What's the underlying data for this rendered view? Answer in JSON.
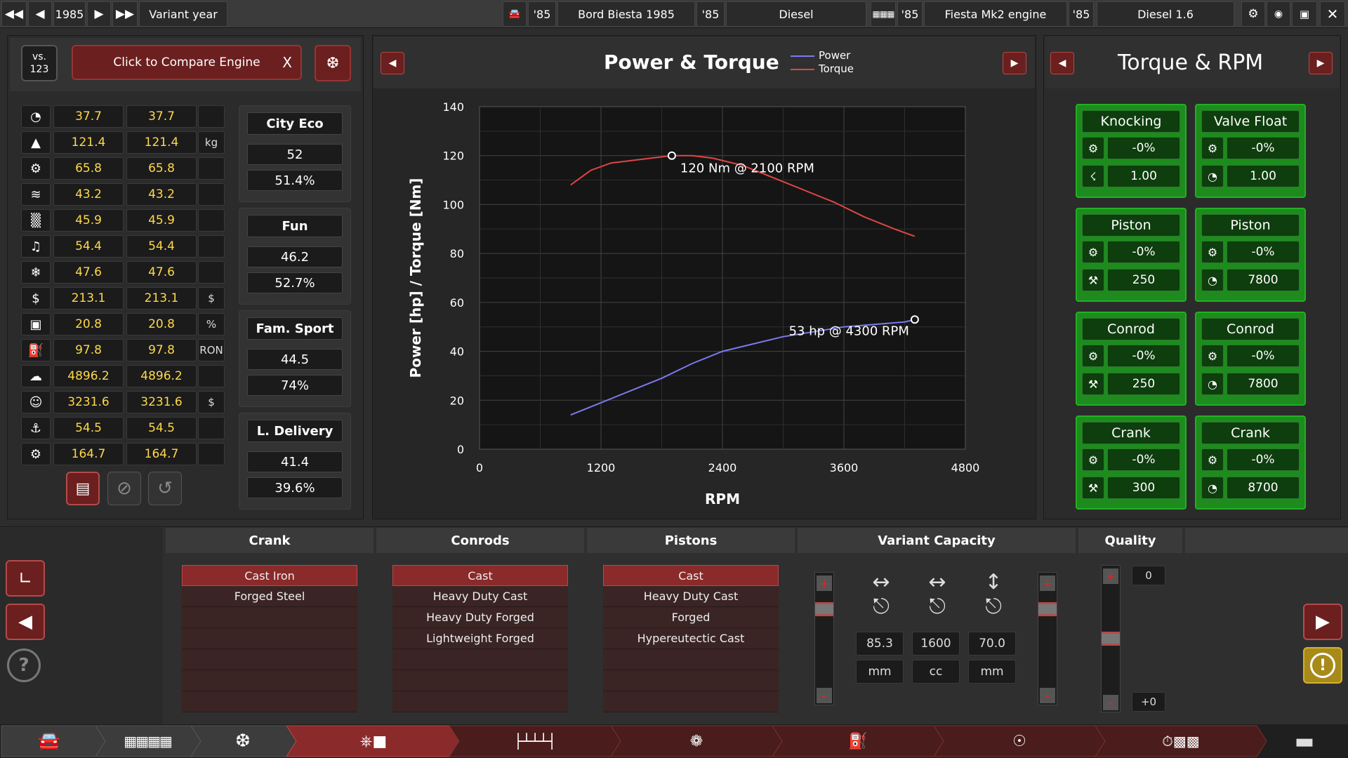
{
  "topbar": {
    "year": "1985",
    "variant_year_label": "Variant year",
    "car_year": "'85",
    "car_name": "Bord Biesta 1985",
    "trim_year": "'85",
    "trim_name": "Diesel",
    "engine_year": "'85",
    "engine_name": "Fiesta Mk2 engine",
    "variant_year": "'85",
    "variant_name": "Diesel 1.6"
  },
  "compare": {
    "vs_label": "vs.\n123",
    "compare_label": "Click to Compare Engine",
    "close": "X"
  },
  "stats": [
    {
      "icon": "speedometer-icon",
      "a": "37.7",
      "b": "37.7",
      "unit": ""
    },
    {
      "icon": "weight-icon",
      "a": "121.4",
      "b": "121.4",
      "unit": "kg"
    },
    {
      "icon": "engine-icon",
      "a": "65.8",
      "b": "65.8",
      "unit": ""
    },
    {
      "icon": "smoothness-icon",
      "a": "43.2",
      "b": "43.2",
      "unit": ""
    },
    {
      "icon": "radiator-icon",
      "a": "45.9",
      "b": "45.9",
      "unit": ""
    },
    {
      "icon": "speaker-icon",
      "a": "54.4",
      "b": "54.4",
      "unit": ""
    },
    {
      "icon": "snowflake-icon",
      "a": "47.6",
      "b": "47.6",
      "unit": ""
    },
    {
      "icon": "engine-cost-icon",
      "a": "213.1",
      "b": "213.1",
      "unit": "$"
    },
    {
      "icon": "fuel-can-icon",
      "a": "20.8",
      "b": "20.8",
      "unit": "%"
    },
    {
      "icon": "fuel-pump-icon",
      "a": "97.8",
      "b": "97.8",
      "unit": "RON"
    },
    {
      "icon": "engineering-time-icon",
      "a": "4896.2",
      "b": "4896.2",
      "unit": ""
    },
    {
      "icon": "service-cost-icon",
      "a": "3231.6",
      "b": "3231.6",
      "unit": "$"
    },
    {
      "icon": "anvil-icon",
      "a": "54.5",
      "b": "54.5",
      "unit": ""
    },
    {
      "icon": "gear-icon",
      "a": "164.7",
      "b": "164.7",
      "unit": ""
    }
  ],
  "scores": [
    {
      "name": "City Eco",
      "value": "52",
      "percent": "51.4%"
    },
    {
      "name": "Fun",
      "value": "46.2",
      "percent": "52.7%"
    },
    {
      "name": "Fam. Sport",
      "value": "44.5",
      "percent": "74%"
    },
    {
      "name": "L. Delivery",
      "value": "41.4",
      "percent": "39.6%"
    }
  ],
  "chart_panel": {
    "title": "Power & Torque",
    "annotation_torque": "120 Nm @ 2100 RPM",
    "annotation_power": "53 hp @ 4300 RPM"
  },
  "chart_data": {
    "type": "line",
    "title": "Power & Torque",
    "xlabel": "RPM",
    "ylabel": "Power [hp] / Torque [Nm]",
    "xlim": [
      0,
      4800
    ],
    "ylim": [
      0,
      140
    ],
    "xticks": [
      "0",
      "1200",
      "2400",
      "3600",
      "4800"
    ],
    "yticks": [
      "0",
      "20",
      "40",
      "60",
      "80",
      "100",
      "120",
      "140"
    ],
    "legend_position": "top-right",
    "grid": true,
    "series": [
      {
        "name": "Power",
        "color": "#7a7aee",
        "x": [
          900,
          1200,
          1500,
          1800,
          2100,
          2400,
          2700,
          3000,
          3300,
          3600,
          3900,
          4200,
          4300
        ],
        "y": [
          14,
          19,
          24,
          29,
          35,
          40,
          43,
          46,
          48,
          50,
          51,
          52,
          53
        ]
      },
      {
        "name": "Torque",
        "color": "#e04646",
        "x": [
          900,
          1100,
          1300,
          1500,
          1700,
          1900,
          2100,
          2300,
          2600,
          2900,
          3200,
          3500,
          3800,
          4100,
          4300
        ],
        "y": [
          108,
          114,
          117,
          118,
          119,
          120,
          120,
          119,
          116,
          111,
          106,
          101,
          95,
          90,
          87
        ]
      }
    ]
  },
  "tolerance_panel": {
    "title": "Torque & RPM",
    "cards": [
      {
        "title": "Knocking",
        "pct": "-0%",
        "val": "1.00",
        "icon2": "knock-icon"
      },
      {
        "title": "Valve Float",
        "pct": "-0%",
        "val": "1.00",
        "icon2": "rpm-gauge-icon"
      },
      {
        "title": "Piston",
        "pct": "-0%",
        "val": "250",
        "icon2": "wrench-icon"
      },
      {
        "title": "Piston",
        "pct": "-0%",
        "val": "7800",
        "icon2": "rpm-gauge-icon"
      },
      {
        "title": "Conrod",
        "pct": "-0%",
        "val": "250",
        "icon2": "wrench-icon"
      },
      {
        "title": "Conrod",
        "pct": "-0%",
        "val": "7800",
        "icon2": "rpm-gauge-icon"
      },
      {
        "title": "Crank",
        "pct": "-0%",
        "val": "300",
        "icon2": "wrench-icon"
      },
      {
        "title": "Crank",
        "pct": "-0%",
        "val": "8700",
        "icon2": "rpm-gauge-icon"
      }
    ]
  },
  "bottom": {
    "crank_title": "Crank",
    "crank_items": [
      "Cast Iron",
      "Forged Steel"
    ],
    "conrods_title": "Conrods",
    "conrods_items": [
      "Cast",
      "Heavy Duty Cast",
      "Heavy Duty Forged",
      "Lightweight Forged"
    ],
    "pistons_title": "Pistons",
    "pistons_items": [
      "Cast",
      "Heavy Duty Cast",
      "Forged",
      "Hypereutectic Cast"
    ],
    "capacity_title": "Variant Capacity",
    "bore": "85.3",
    "bore_unit": "mm",
    "displacement": "1600",
    "displacement_unit": "cc",
    "stroke": "70.0",
    "stroke_unit": "mm",
    "quality_title": "Quality",
    "quality_top": "0",
    "quality_bottom": "+0"
  },
  "colors": {
    "accent_red": "#8b2a2a",
    "card_green": "#1d8b1d",
    "value_yellow": "#ffd84a"
  }
}
